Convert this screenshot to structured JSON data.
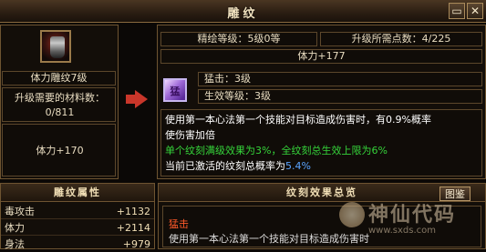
{
  "window": {
    "title": "雕纹",
    "close_glyph": "✕",
    "minimize_glyph": "▭"
  },
  "left": {
    "item_name": "体力雕纹7级",
    "materials_label": "升级需要的材料数：",
    "materials_value": "0/811",
    "attribute": "体力+170"
  },
  "right": {
    "refine_level": "精绘等级：5级0等",
    "points_needed": "升级所需点数：4/225",
    "attribute": "体力+177",
    "skill_line": "猛击：3级",
    "effect_level": "生效等级：3级",
    "desc_line1": "使用第一本心法第一个技能对目标造成伤害时，有0.9%概率",
    "desc_line2": "使伤害加倍",
    "bonus_line": "单个纹刻满级效果为3%，全纹刻总生效上限为6%",
    "active_prefix": "当前已激活的纹刻总概率为",
    "active_value": "5.4%",
    "gem_glyph": "猛"
  },
  "attributes_panel": {
    "header": "雕纹属性",
    "rows": [
      {
        "name": "毒攻击",
        "value": "+1132"
      },
      {
        "name": "体力",
        "value": "+2114"
      },
      {
        "name": "身法",
        "value": "+979"
      }
    ]
  },
  "effects_panel": {
    "header": "纹刻效果总览",
    "illustration_button": "图鉴",
    "entry_name": "猛击",
    "entry_desc": "使用第一本心法第一个技能对目标造成伤害时"
  },
  "watermark": {
    "main": "神仙代码",
    "url": "www.sxds.com"
  },
  "colors": {
    "frame": "#6e5431",
    "green_text": "#35d43a",
    "blue_text": "#5aa4ff",
    "accent_red": "#c9362a"
  }
}
